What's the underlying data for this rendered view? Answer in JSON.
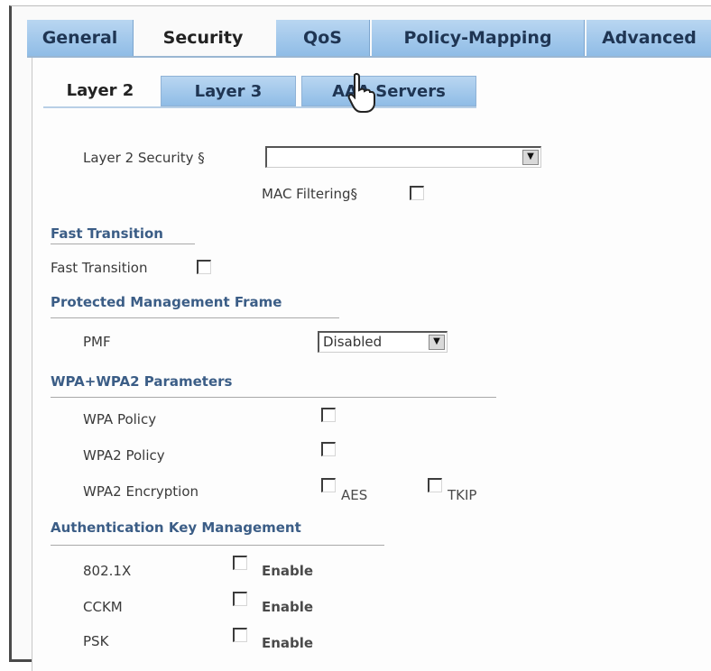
{
  "main_tabs": [
    {
      "label": "General"
    },
    {
      "label": "Security"
    },
    {
      "label": "QoS"
    },
    {
      "label": "Policy-Mapping"
    },
    {
      "label": "Advanced"
    }
  ],
  "sub_tabs": [
    {
      "label": "Layer 2"
    },
    {
      "label": "Layer 3"
    },
    {
      "label": "AAA Servers"
    }
  ],
  "layer2": {
    "security_label": "Layer 2 Security",
    "security_marker": "§",
    "security_value": "",
    "mac_filtering_label": "MAC Filtering",
    "mac_filtering_marker": "§"
  },
  "fast_transition": {
    "section": "Fast Transition",
    "label": "Fast Transition"
  },
  "pmf": {
    "section": "Protected Management Frame",
    "label": "PMF",
    "value": "Disabled"
  },
  "wpa": {
    "section": "WPA+WPA2 Parameters",
    "wpa_policy": "WPA Policy",
    "wpa2_policy": "WPA2 Policy",
    "wpa2_encryption": "WPA2 Encryption",
    "aes": "AES",
    "tkip": "TKIP"
  },
  "akm": {
    "section": "Authentication Key Management",
    "rows": [
      {
        "label": "802.1X",
        "option": "Enable"
      },
      {
        "label": "CCKM",
        "option": "Enable"
      },
      {
        "label": "PSK",
        "option": "Enable"
      }
    ]
  }
}
